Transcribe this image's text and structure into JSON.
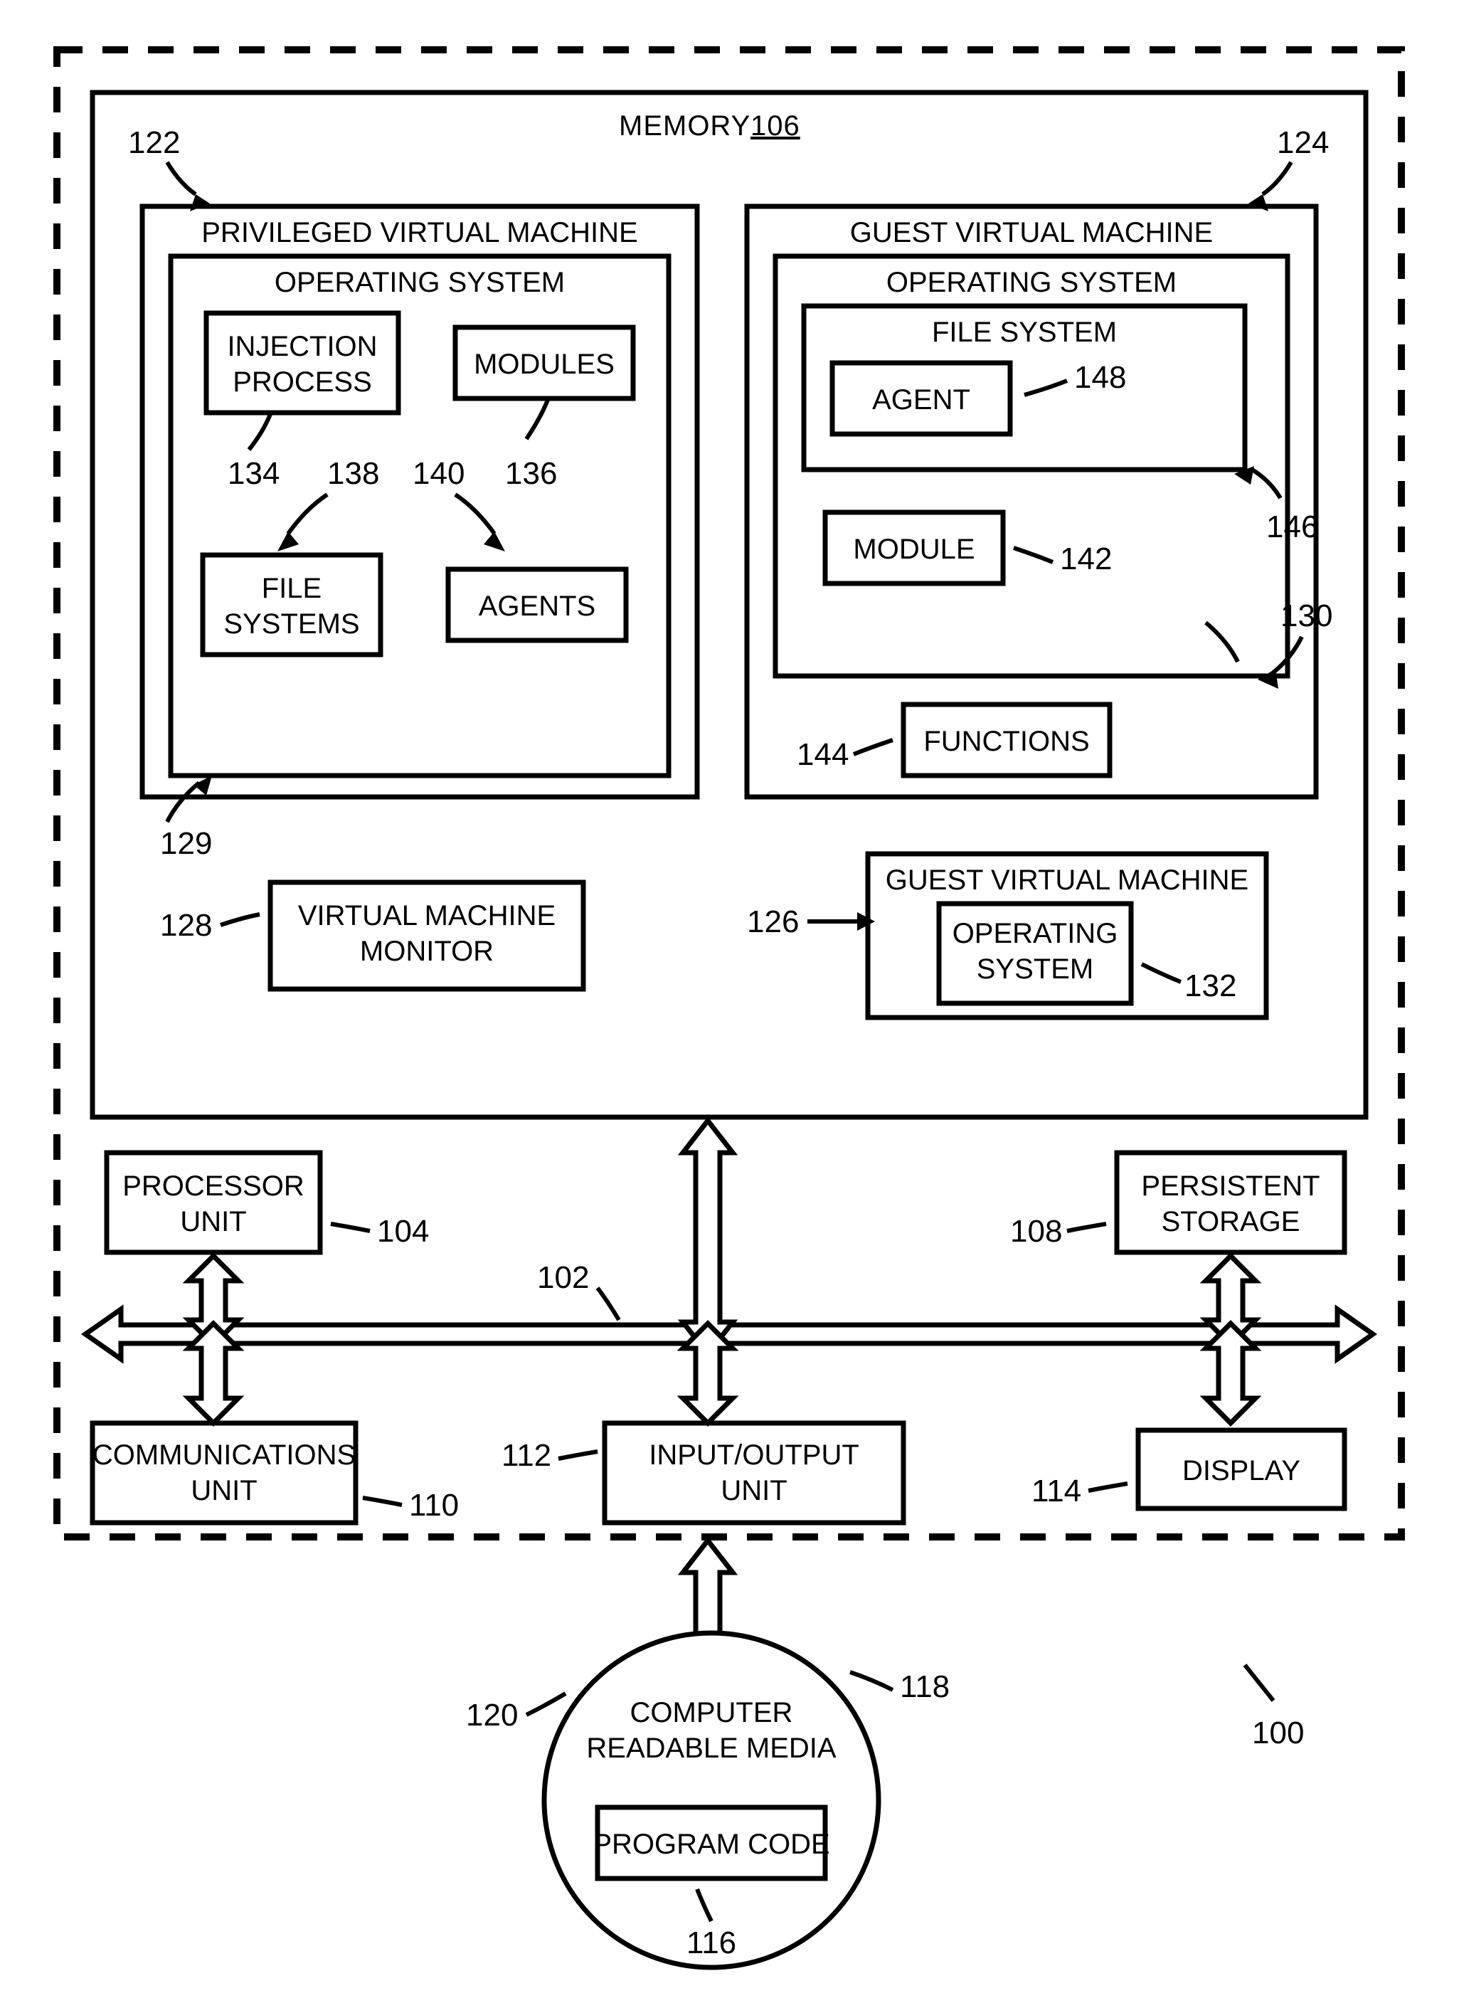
{
  "memory": {
    "title": "MEMORY",
    "ref": "106"
  },
  "priv_vm": {
    "title": "PRIVILEGED VIRTUAL MACHINE",
    "ref": "122",
    "os": {
      "title": "OPERATING SYSTEM",
      "ref": "129"
    },
    "injection": {
      "label1": "INJECTION",
      "label2": "PROCESS",
      "ref": "134"
    },
    "modules": {
      "label": "MODULES",
      "ref": "136"
    },
    "fs": {
      "label1": "FILE",
      "label2": "SYSTEMS",
      "ref": "138"
    },
    "agents": {
      "label": "AGENTS",
      "ref": "140"
    }
  },
  "guest_vm": {
    "title": "GUEST VIRTUAL MACHINE",
    "ref": "124",
    "os": {
      "title": "OPERATING SYSTEM",
      "ref": "130"
    },
    "fs": {
      "title": "FILE SYSTEM",
      "ref": "146"
    },
    "agent": {
      "label": "AGENT",
      "ref": "148"
    },
    "module": {
      "label": "MODULE",
      "ref": "142"
    },
    "functions": {
      "label": "FUNCTIONS",
      "ref": "144"
    }
  },
  "vmm": {
    "label1": "VIRTUAL MACHINE",
    "label2": "MONITOR",
    "ref": "128"
  },
  "guest_vm2": {
    "title": "GUEST VIRTUAL MACHINE",
    "ref": "126",
    "os": {
      "label1": "OPERATING",
      "label2": "SYSTEM",
      "ref": "132"
    }
  },
  "proc": {
    "label1": "PROCESSOR",
    "label2": "UNIT",
    "ref": "104"
  },
  "pstor": {
    "label1": "PERSISTENT",
    "label2": "STORAGE",
    "ref": "108"
  },
  "comm": {
    "label1": "COMMUNICATIONS",
    "label2": "UNIT",
    "ref": "110"
  },
  "io": {
    "label": "INPUT/OUTPUT UNIT",
    "ref": "112"
  },
  "disp": {
    "label": "DISPLAY",
    "ref": "114"
  },
  "bus": {
    "ref": "102"
  },
  "crm": {
    "label1": "COMPUTER",
    "label2": "READABLE MEDIA",
    "ref": "118",
    "ref2": "120"
  },
  "pcode": {
    "label": "PROGRAM CODE",
    "ref": "116"
  },
  "system": {
    "ref": "100"
  }
}
